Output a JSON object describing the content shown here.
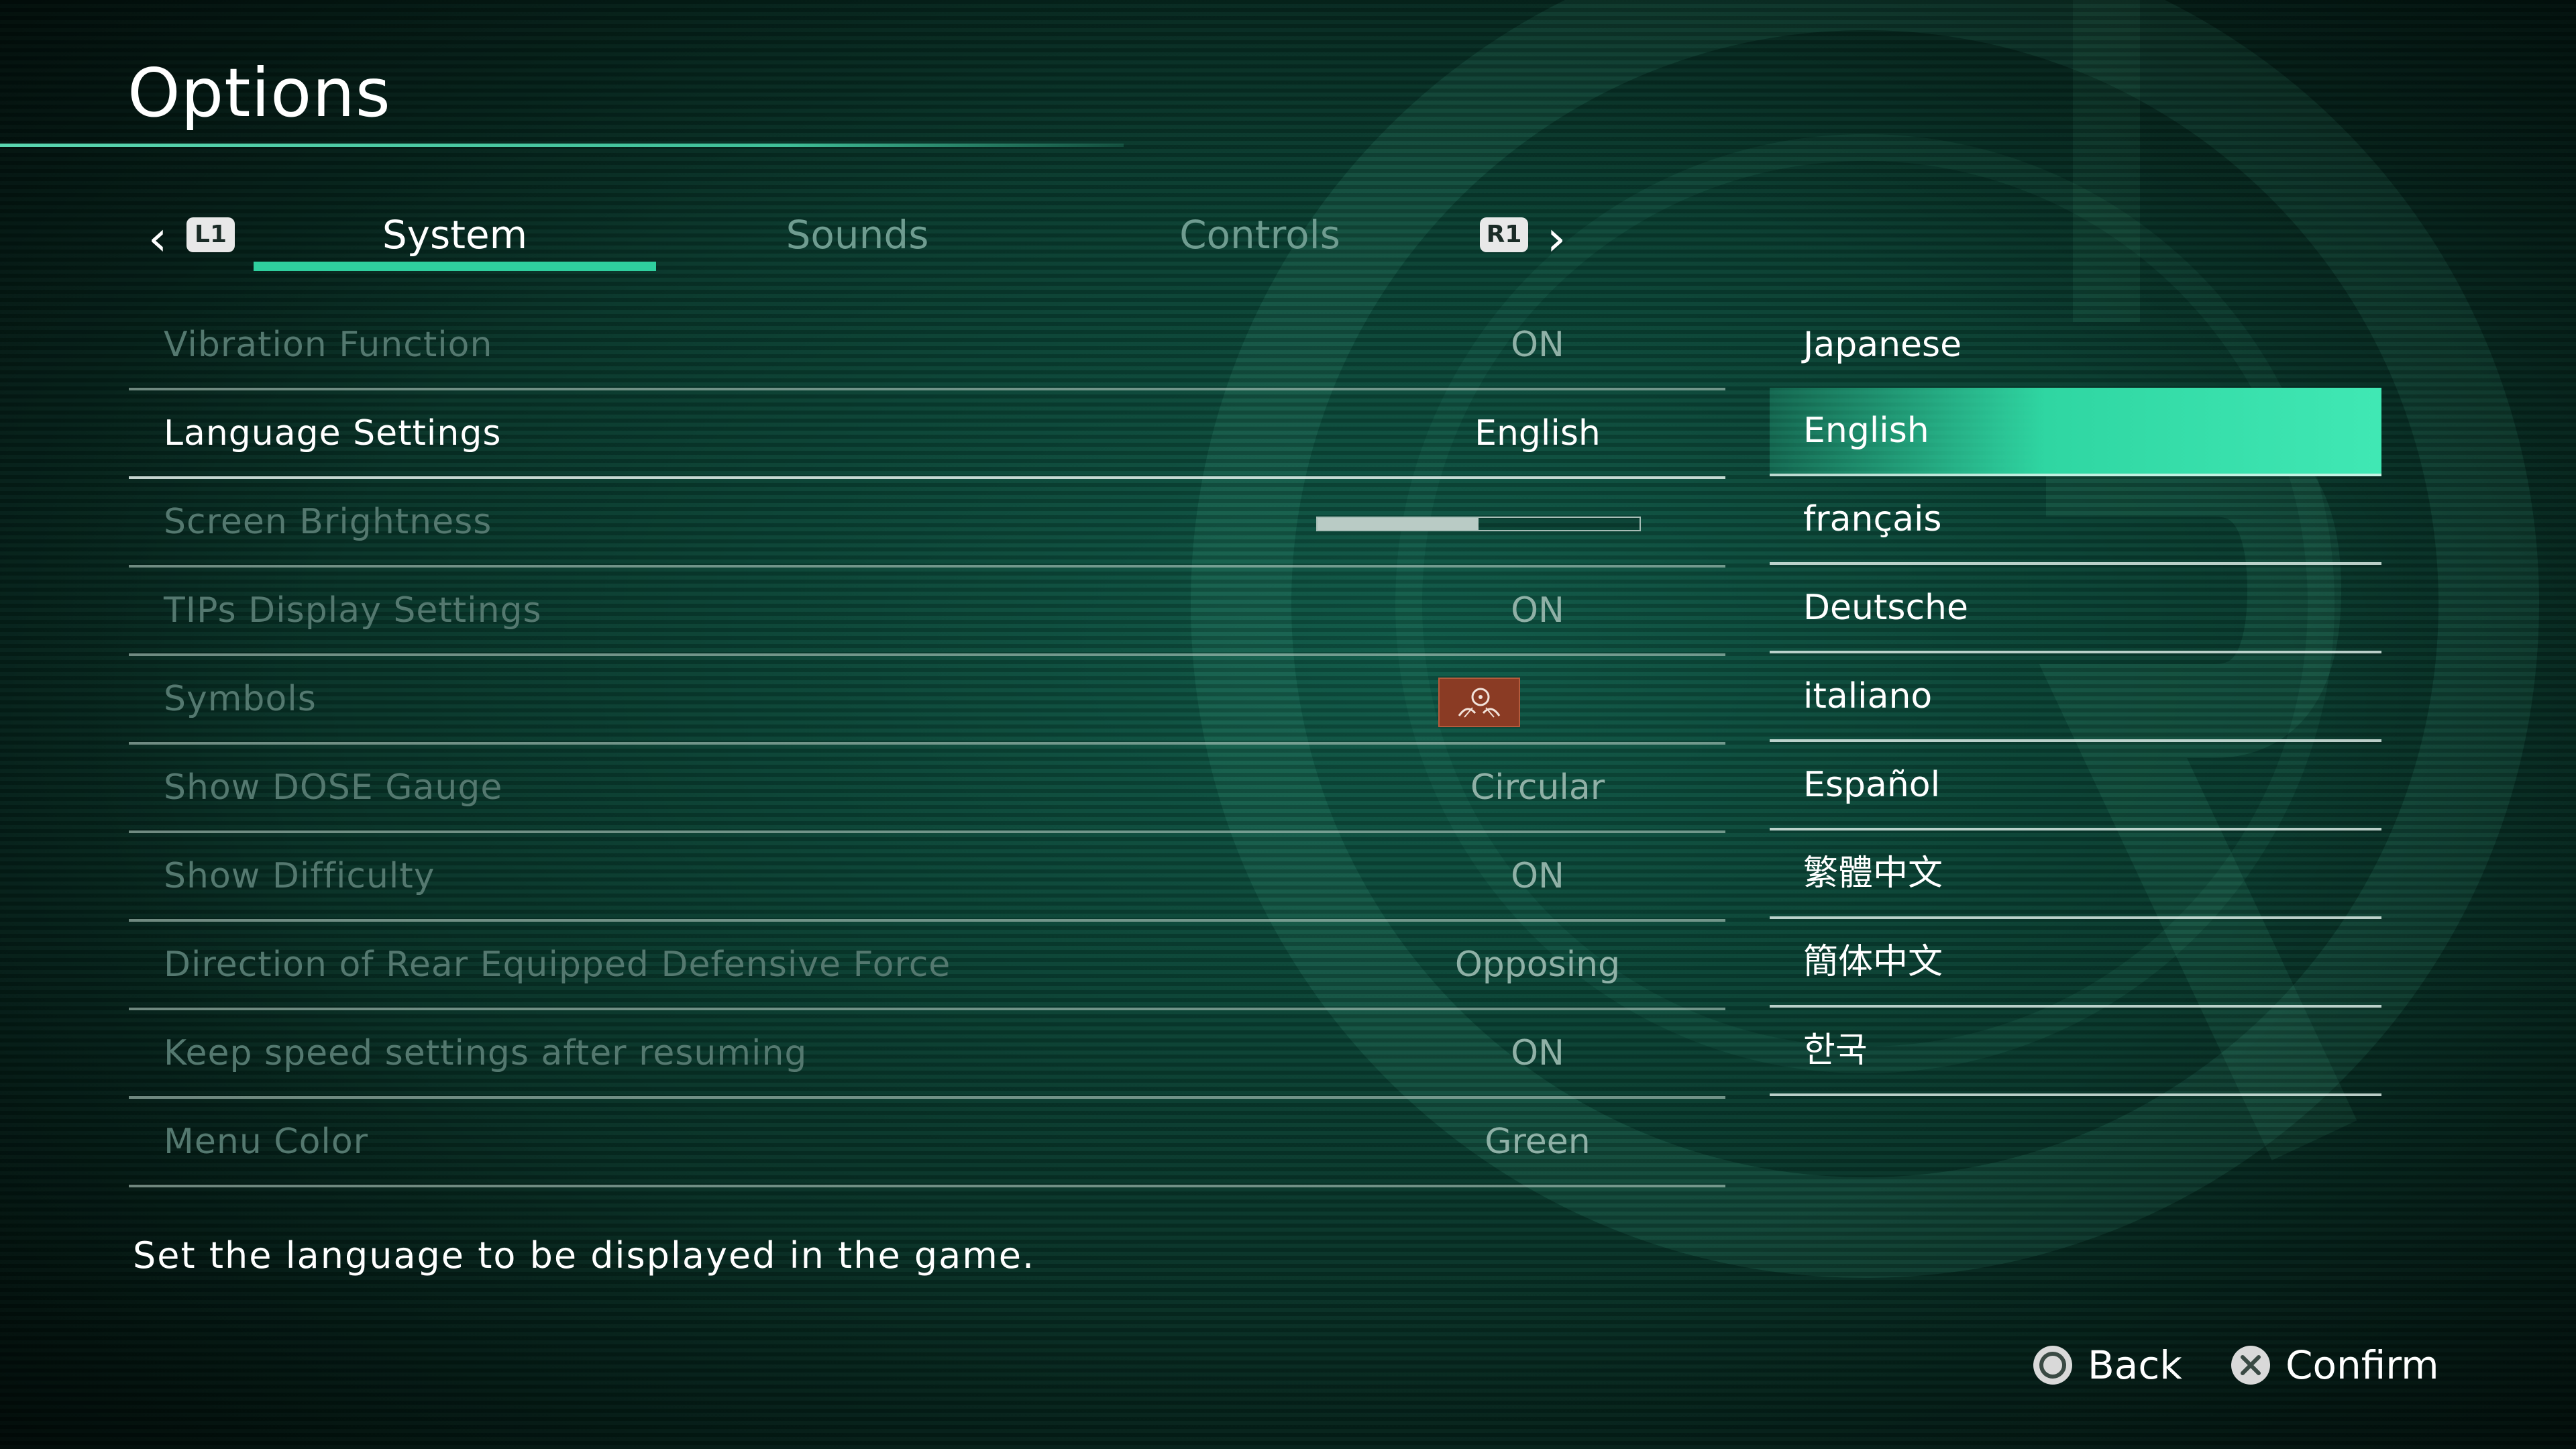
{
  "colors": {
    "accent": "#2fcf9e",
    "background": "#0a4234",
    "symbol_badge": "#8a3b24"
  },
  "header": {
    "title": "Options"
  },
  "tabs": {
    "left_shoulder": "L1",
    "right_shoulder": "R1",
    "items": [
      {
        "label": "System",
        "active": true
      },
      {
        "label": "Sounds",
        "active": false
      },
      {
        "label": "Controls",
        "active": false
      }
    ]
  },
  "settings": [
    {
      "label": "Vibration Function",
      "value": "ON"
    },
    {
      "label": "Language Settings",
      "value": "English",
      "active": true
    },
    {
      "label": "Screen Brightness",
      "value_type": "slider",
      "level_fraction": 0.5
    },
    {
      "label": "TIPs Display Settings",
      "value": "ON"
    },
    {
      "label": "Symbols",
      "value_type": "icon",
      "icon": "symbol-emblem-icon"
    },
    {
      "label": "Show DOSE Gauge",
      "value": "Circular"
    },
    {
      "label": "Show Difficulty",
      "value": "ON"
    },
    {
      "label": "Direction of Rear Equipped Defensive Force",
      "value": "Opposing"
    },
    {
      "label": "Keep speed settings after resuming",
      "value": "ON"
    },
    {
      "label": "Menu Color",
      "value": "Green"
    }
  ],
  "languages": [
    {
      "label": "Japanese"
    },
    {
      "label": "English",
      "selected": true
    },
    {
      "label": "français"
    },
    {
      "label": "Deutsche"
    },
    {
      "label": "italiano"
    },
    {
      "label": "Español"
    },
    {
      "label": "繁體中文"
    },
    {
      "label": "簡体中文"
    },
    {
      "label": "한국"
    }
  ],
  "help_text": "Set the language to be displayed in the game.",
  "footer": {
    "back_label": "Back",
    "back_icon": "circle-button-icon",
    "confirm_label": "Confirm",
    "confirm_icon": "cross-button-icon"
  }
}
